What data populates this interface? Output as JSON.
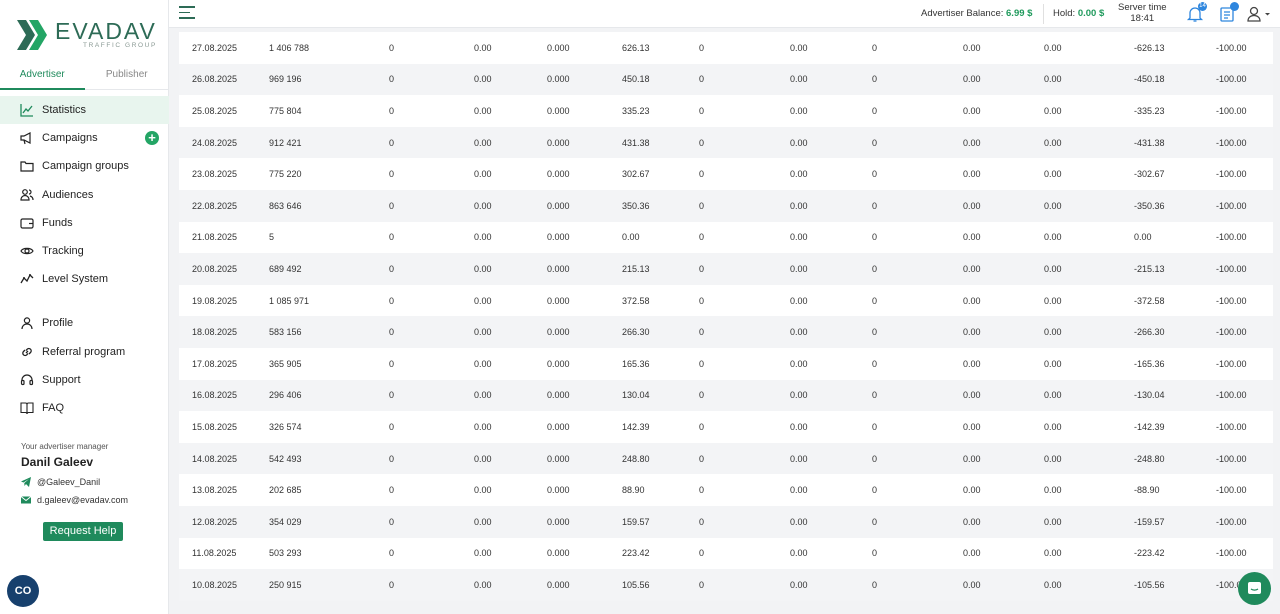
{
  "brand": {
    "name": "EVADAV",
    "tagline": "TRAFFIC GROUP",
    "color": "#1f8a5c"
  },
  "roles": [
    {
      "label": "Advertiser",
      "active": true
    },
    {
      "label": "Publisher",
      "active": false
    }
  ],
  "menu": [
    {
      "label": "Statistics",
      "icon": "chart-icon",
      "active": true
    },
    {
      "label": "Campaigns",
      "icon": "megaphone-icon",
      "plus": "+"
    },
    {
      "label": "Campaign groups",
      "icon": "folder-icon"
    },
    {
      "label": "Audiences",
      "icon": "users-icon"
    },
    {
      "label": "Funds",
      "icon": "wallet-icon"
    },
    {
      "label": "Tracking",
      "icon": "eye-icon"
    },
    {
      "label": "Level System",
      "icon": "trend-icon"
    }
  ],
  "menu2": [
    {
      "label": "Profile",
      "icon": "user-icon"
    },
    {
      "label": "Referral program",
      "icon": "link-icon"
    },
    {
      "label": "Support",
      "icon": "headset-icon"
    },
    {
      "label": "FAQ",
      "icon": "book-icon"
    }
  ],
  "manager": {
    "label": "Your advertiser manager",
    "name": "Danil Galeev",
    "telegram": "@Galeev_Danil",
    "email": "d.galeev@evadav.com",
    "help_label": "Request Help"
  },
  "round_button": "CO",
  "header": {
    "balance_label": "Advertiser Balance:",
    "balance_value": "6.99 $",
    "hold_label": "Hold:",
    "hold_value": "0.00 $",
    "server_time_label": "Server time",
    "server_time_value": "18:41",
    "notif_count": "14"
  },
  "table": {
    "rows": [
      [
        "27.08.2025",
        "1 406 788",
        "0",
        "0.00",
        "0.000",
        "626.13",
        "0",
        "0.00",
        "0",
        "0.00",
        "0.00",
        "-626.13",
        "-100.00"
      ],
      [
        "26.08.2025",
        "969 196",
        "0",
        "0.00",
        "0.000",
        "450.18",
        "0",
        "0.00",
        "0",
        "0.00",
        "0.00",
        "-450.18",
        "-100.00"
      ],
      [
        "25.08.2025",
        "775 804",
        "0",
        "0.00",
        "0.000",
        "335.23",
        "0",
        "0.00",
        "0",
        "0.00",
        "0.00",
        "-335.23",
        "-100.00"
      ],
      [
        "24.08.2025",
        "912 421",
        "0",
        "0.00",
        "0.000",
        "431.38",
        "0",
        "0.00",
        "0",
        "0.00",
        "0.00",
        "-431.38",
        "-100.00"
      ],
      [
        "23.08.2025",
        "775 220",
        "0",
        "0.00",
        "0.000",
        "302.67",
        "0",
        "0.00",
        "0",
        "0.00",
        "0.00",
        "-302.67",
        "-100.00"
      ],
      [
        "22.08.2025",
        "863 646",
        "0",
        "0.00",
        "0.000",
        "350.36",
        "0",
        "0.00",
        "0",
        "0.00",
        "0.00",
        "-350.36",
        "-100.00"
      ],
      [
        "21.08.2025",
        "5",
        "0",
        "0.00",
        "0.000",
        "0.00",
        "0",
        "0.00",
        "0",
        "0.00",
        "0.00",
        "0.00",
        "-100.00"
      ],
      [
        "20.08.2025",
        "689 492",
        "0",
        "0.00",
        "0.000",
        "215.13",
        "0",
        "0.00",
        "0",
        "0.00",
        "0.00",
        "-215.13",
        "-100.00"
      ],
      [
        "19.08.2025",
        "1 085 971",
        "0",
        "0.00",
        "0.000",
        "372.58",
        "0",
        "0.00",
        "0",
        "0.00",
        "0.00",
        "-372.58",
        "-100.00"
      ],
      [
        "18.08.2025",
        "583 156",
        "0",
        "0.00",
        "0.000",
        "266.30",
        "0",
        "0.00",
        "0",
        "0.00",
        "0.00",
        "-266.30",
        "-100.00"
      ],
      [
        "17.08.2025",
        "365 905",
        "0",
        "0.00",
        "0.000",
        "165.36",
        "0",
        "0.00",
        "0",
        "0.00",
        "0.00",
        "-165.36",
        "-100.00"
      ],
      [
        "16.08.2025",
        "296 406",
        "0",
        "0.00",
        "0.000",
        "130.04",
        "0",
        "0.00",
        "0",
        "0.00",
        "0.00",
        "-130.04",
        "-100.00"
      ],
      [
        "15.08.2025",
        "326 574",
        "0",
        "0.00",
        "0.000",
        "142.39",
        "0",
        "0.00",
        "0",
        "0.00",
        "0.00",
        "-142.39",
        "-100.00"
      ],
      [
        "14.08.2025",
        "542 493",
        "0",
        "0.00",
        "0.000",
        "248.80",
        "0",
        "0.00",
        "0",
        "0.00",
        "0.00",
        "-248.80",
        "-100.00"
      ],
      [
        "13.08.2025",
        "202 685",
        "0",
        "0.00",
        "0.000",
        "88.90",
        "0",
        "0.00",
        "0",
        "0.00",
        "0.00",
        "-88.90",
        "-100.00"
      ],
      [
        "12.08.2025",
        "354 029",
        "0",
        "0.00",
        "0.000",
        "159.57",
        "0",
        "0.00",
        "0",
        "0.00",
        "0.00",
        "-159.57",
        "-100.00"
      ],
      [
        "11.08.2025",
        "503 293",
        "0",
        "0.00",
        "0.000",
        "223.42",
        "0",
        "0.00",
        "0",
        "0.00",
        "0.00",
        "-223.42",
        "-100.00"
      ],
      [
        "10.08.2025",
        "250 915",
        "0",
        "0.00",
        "0.000",
        "105.56",
        "0",
        "0.00",
        "0",
        "0.00",
        "0.00",
        "-105.56",
        "-100.00"
      ]
    ]
  }
}
